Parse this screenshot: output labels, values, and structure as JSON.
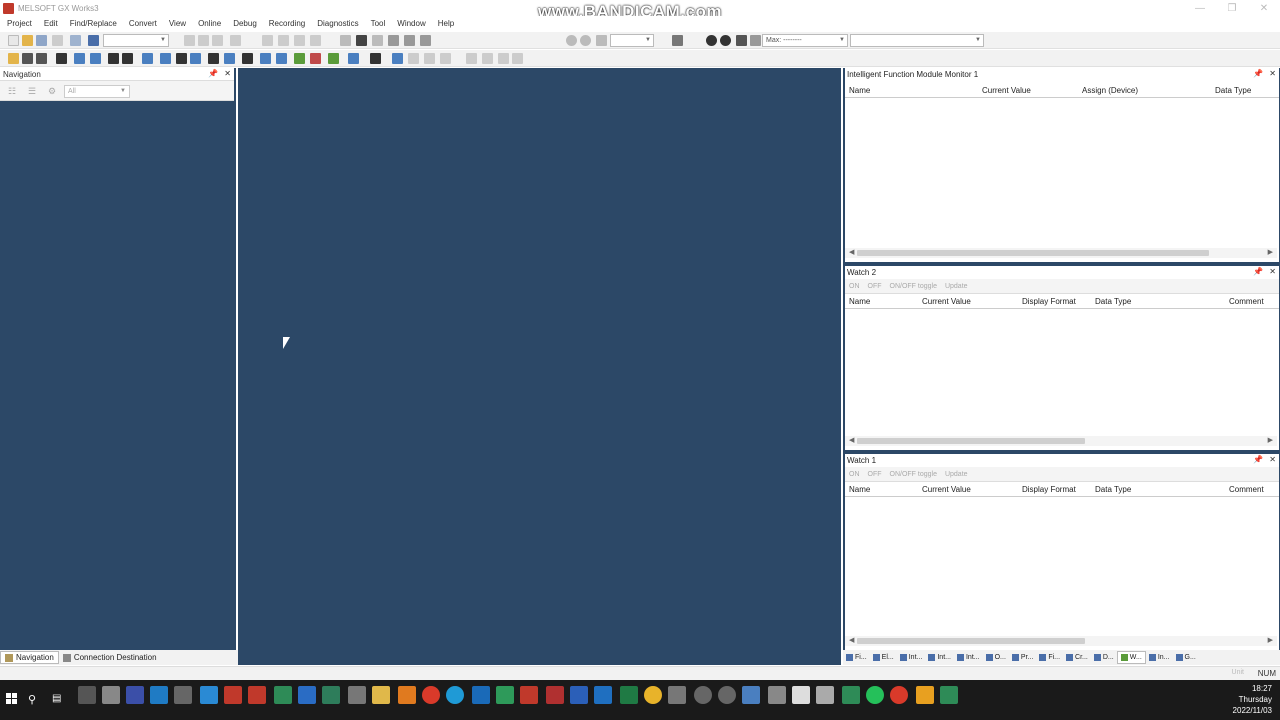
{
  "window": {
    "title": "MELSOFT GX Works3",
    "watermark": "www.BANDICAM.com"
  },
  "menu": [
    "Project",
    "Edit",
    "Find/Replace",
    "Convert",
    "View",
    "Online",
    "Debug",
    "Recording",
    "Diagnostics",
    "Tool",
    "Window",
    "Help"
  ],
  "toolbar": {
    "max_label": "Max: --------"
  },
  "navigation": {
    "title": "Navigation",
    "filter_value": "All",
    "tabs": [
      {
        "label": "Navigation"
      },
      {
        "label": "Connection Destination"
      }
    ]
  },
  "panels": {
    "ifm_monitor": {
      "title": "Intelligent Function Module Monitor 1",
      "columns": [
        "Name",
        "Current Value",
        "Assign (Device)",
        "Data Type"
      ]
    },
    "watch2": {
      "title": "Watch 2",
      "tools": [
        "ON",
        "OFF",
        "ON/OFF toggle",
        "Update"
      ],
      "columns": [
        "Name",
        "Current Value",
        "Display Format",
        "Data Type",
        "Comment"
      ]
    },
    "watch1": {
      "title": "Watch 1",
      "tools": [
        "ON",
        "OFF",
        "ON/OFF toggle",
        "Update"
      ],
      "columns": [
        "Name",
        "Current Value",
        "Display Format",
        "Data Type",
        "Comment"
      ]
    }
  },
  "right_tabs": [
    "Fi...",
    "El...",
    "Int...",
    "Int...",
    "Int...",
    "O...",
    "Pr...",
    "Fi...",
    "Cr...",
    "D...",
    "W...",
    "In...",
    "G..."
  ],
  "status": {
    "mode": "Unit",
    "num": "NUM"
  },
  "taskbar": {
    "time": "18:27",
    "day": "Thursday",
    "date": "2022/11/03"
  },
  "colors": {
    "workspace": "#2c4867",
    "accent": "#c0392b"
  }
}
